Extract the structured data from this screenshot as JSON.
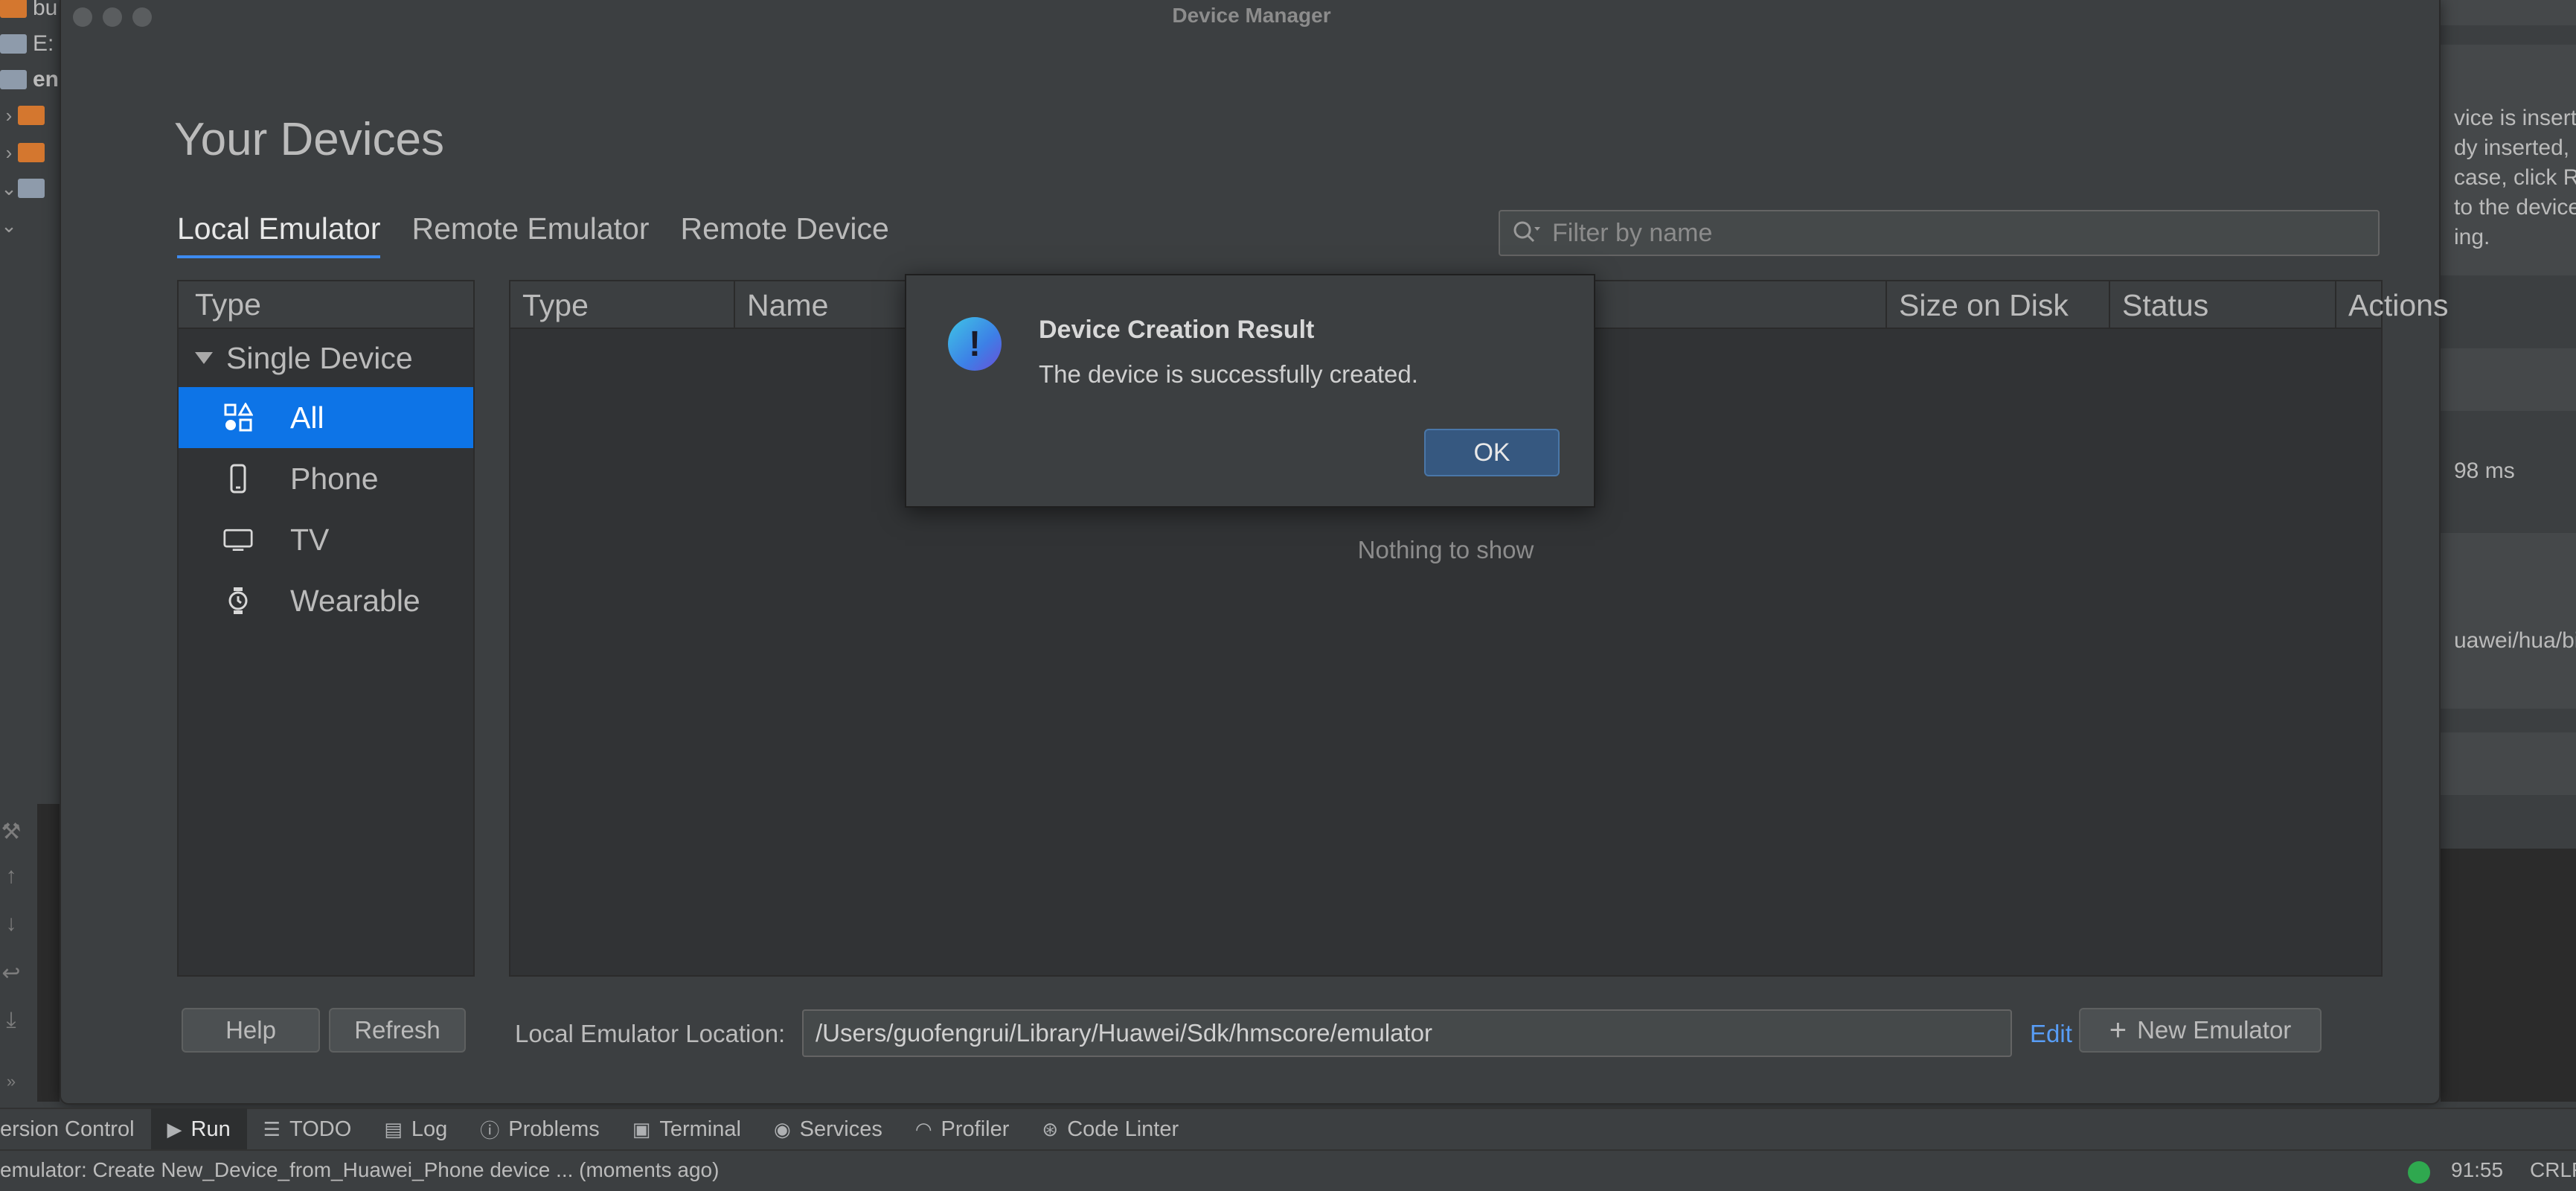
{
  "ide": {
    "project_tree": [
      {
        "label": "bu",
        "folder": "orange",
        "arrow": ""
      },
      {
        "label": "E:",
        "folder": "gray",
        "arrow": ""
      },
      {
        "label": "en",
        "folder": "gray",
        "arrow": ""
      },
      {
        "label": "",
        "folder": "orange",
        "arrow": "›"
      },
      {
        "label": "",
        "folder": "orange",
        "arrow": "›"
      },
      {
        "label": "",
        "folder": "gray",
        "arrow": "⌄"
      },
      {
        "label": "",
        "folder": "",
        "arrow": "⌄"
      }
    ],
    "right_panel": {
      "text_lines": [
        "vice is inserte",
        "dy inserted, it",
        " case, click R",
        "to the device",
        "ing."
      ],
      "timing": "98 ms",
      "path": "uawei/hua/bin"
    },
    "bottom_tabs": [
      {
        "label": "ersion Control",
        "icon": ""
      },
      {
        "label": "Run",
        "icon": "▶",
        "icon_name": "run-icon",
        "active": true
      },
      {
        "label": "TODO",
        "icon": "☰",
        "icon_name": "todo-icon"
      },
      {
        "label": "Log",
        "icon": "▤",
        "icon_name": "log-icon"
      },
      {
        "label": "Problems",
        "icon": "ⓘ",
        "icon_name": "problems-icon"
      },
      {
        "label": "Terminal",
        "icon": "▣",
        "icon_name": "terminal-icon"
      },
      {
        "label": "Services",
        "icon": "◉",
        "icon_name": "services-icon"
      },
      {
        "label": "Profiler",
        "icon": "◠",
        "icon_name": "profiler-icon"
      },
      {
        "label": "Code Linter",
        "icon": "⊛",
        "icon_name": "code-linter-icon"
      }
    ],
    "status_message": "emulator: Create New_Device_from_Huawei_Phone device ... (moments ago)",
    "cursor_position": "91:55",
    "line_ending": "CRLF",
    "status_color": "#2fa84f"
  },
  "device_manager": {
    "window_title": "Device Manager",
    "page_title": "Your Devices",
    "tabs": [
      {
        "label": "Local Emulator",
        "active": true
      },
      {
        "label": "Remote Emulator",
        "active": false
      },
      {
        "label": "Remote Device",
        "active": false
      }
    ],
    "filter_placeholder": "Filter by name",
    "type_panel": {
      "header": "Type",
      "group": "Single Device",
      "items": [
        {
          "label": "All",
          "icon": "all-categories-icon",
          "selected": true
        },
        {
          "label": "Phone",
          "icon": "phone-icon",
          "selected": false
        },
        {
          "label": "TV",
          "icon": "tv-icon",
          "selected": false
        },
        {
          "label": "Wearable",
          "icon": "watch-icon",
          "selected": false
        }
      ]
    },
    "table": {
      "columns": [
        "Type",
        "Name",
        "Size on Disk",
        "Status",
        "Actions"
      ],
      "empty_text": "Nothing to show"
    },
    "footer": {
      "help_label": "Help",
      "refresh_label": "Refresh",
      "location_label": "Local Emulator Location:",
      "location_value": "/Users/guofengrui/Library/Huawei/Sdk/hmscore/emulator",
      "edit_label": "Edit",
      "new_emulator_label": "New Emulator"
    },
    "accent_color": "#0d74e7"
  },
  "dialog": {
    "title": "Device Creation Result",
    "message": "The device is successfully created.",
    "ok_label": "OK",
    "icon": "info-icon"
  }
}
